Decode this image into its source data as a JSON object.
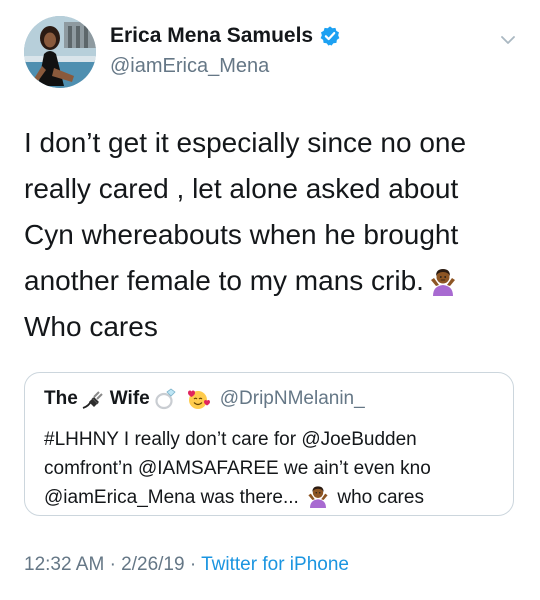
{
  "author": {
    "display_name": "Erica Mena Samuels",
    "handle": "@iamErica_Mena",
    "verified": true
  },
  "tweet": {
    "lines": [
      "I don’t get it especially since no one",
      "really cared , let alone asked about",
      "Cyn whereabouts when he brought",
      "another female to my mans crib.",
      "Who cares"
    ]
  },
  "quote": {
    "name_part1": "The",
    "name_part2": "Wife",
    "handle": "@DripNMelanin_",
    "lines": [
      "#LHHNY  I really don’t care for @JoeBudden",
      "comfront’n @IAMSAFAREE we ain’t even kno",
      "@iamErica_Mena was there...",
      "who cares"
    ]
  },
  "meta": {
    "time": "12:32 AM",
    "date": "2/26/19",
    "separator": "·",
    "source": "Twitter for iPhone"
  },
  "icons": {
    "verified": "verified-badge-icon",
    "caret": "chevron-down-icon",
    "shrug": "person-shrugging-emoji",
    "plug": "electric-plug-emoji",
    "ring": "ring-emoji",
    "smiling_hearts": "smiling-face-with-hearts-emoji"
  },
  "colors": {
    "text": "#14171a",
    "secondary": "#657786",
    "link": "#1b95e0",
    "verified": "#1da1f2",
    "border": "#ccd6dd"
  }
}
